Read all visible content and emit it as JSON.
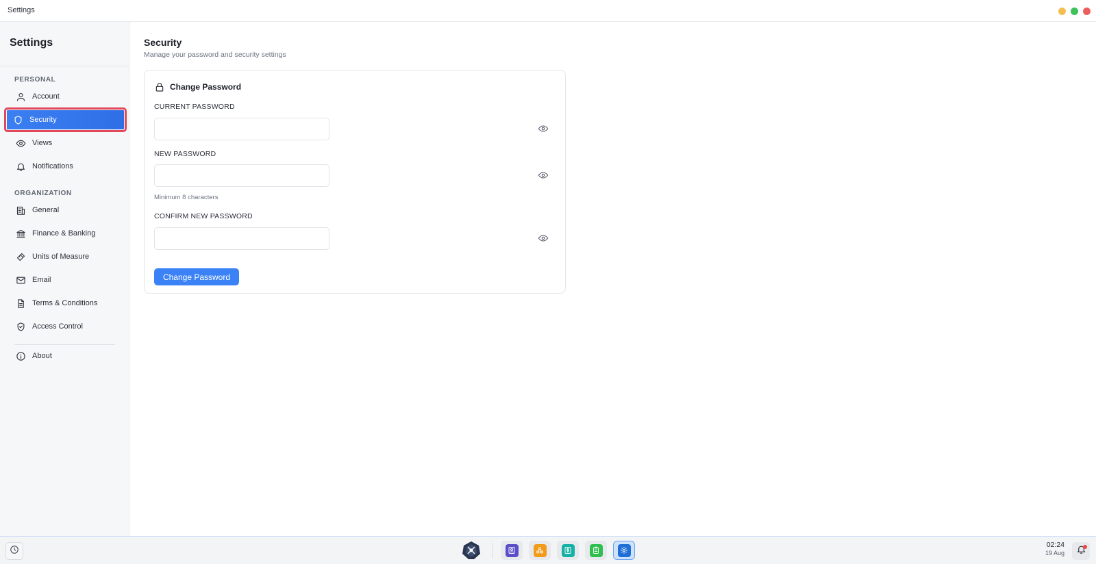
{
  "window": {
    "title": "Settings",
    "controls": {
      "minimize_color": "#f5bf4f",
      "maximize_color": "#3fc15b",
      "close_color": "#ee5d5d"
    }
  },
  "sidebar": {
    "title": "Settings",
    "sections": [
      {
        "label": "PERSONAL",
        "items": [
          {
            "label": "Account",
            "icon": "user-icon"
          },
          {
            "label": "Security",
            "icon": "shield-icon",
            "active": true
          },
          {
            "label": "Views",
            "icon": "eye-icon"
          },
          {
            "label": "Notifications",
            "icon": "bell-icon"
          }
        ]
      },
      {
        "label": "ORGANIZATION",
        "items": [
          {
            "label": "General",
            "icon": "building-icon"
          },
          {
            "label": "Finance & Banking",
            "icon": "bank-icon"
          },
          {
            "label": "Units of Measure",
            "icon": "ruler-icon"
          },
          {
            "label": "Email",
            "icon": "mail-icon"
          },
          {
            "label": "Terms & Conditions",
            "icon": "document-icon"
          },
          {
            "label": "Access Control",
            "icon": "shield-check-icon"
          }
        ]
      }
    ],
    "footer_item": {
      "label": "About",
      "icon": "info-icon"
    }
  },
  "main": {
    "title": "Security",
    "subtitle": "Manage your password and security settings",
    "card": {
      "title": "Change Password",
      "icon": "lock-icon",
      "fields": [
        {
          "label": "CURRENT PASSWORD",
          "value": "",
          "placeholder": "",
          "hint": ""
        },
        {
          "label": "NEW PASSWORD",
          "value": "",
          "placeholder": "",
          "hint": "Minimum 8 characters"
        },
        {
          "label": "CONFIRM NEW PASSWORD",
          "value": "",
          "placeholder": "",
          "hint": ""
        }
      ],
      "submit_label": "Change Password"
    }
  },
  "taskbar": {
    "apps": [
      {
        "icon": "contacts-app-icon",
        "color": "#5b4fc9"
      },
      {
        "icon": "network-app-icon",
        "color": "#f29a1a"
      },
      {
        "icon": "finance-app-icon",
        "color": "#16b1a5"
      },
      {
        "icon": "clipboard-app-icon",
        "color": "#2fbf4f"
      },
      {
        "icon": "settings-app-icon",
        "color": "#1f6fd6",
        "active": true
      }
    ],
    "clock": {
      "time": "02:24",
      "date": "19 Aug"
    },
    "notification_dot_color": "#ef4444"
  }
}
